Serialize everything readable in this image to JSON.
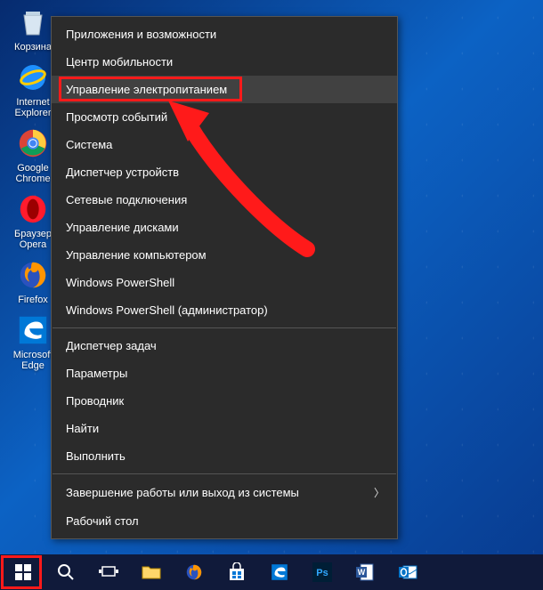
{
  "desktop": {
    "icons": [
      {
        "name": "recycle-bin",
        "label": "Корзина"
      },
      {
        "name": "ie",
        "label": "Internet Explorer"
      },
      {
        "name": "chrome",
        "label": "Google Chrome"
      },
      {
        "name": "opera",
        "label": "Браузер Opera"
      },
      {
        "name": "firefox",
        "label": "Firefox"
      },
      {
        "name": "edge",
        "label": "Microsoft Edge"
      }
    ]
  },
  "context_menu": {
    "groups": [
      [
        {
          "key": "apps-features",
          "label": "Приложения и возможности"
        },
        {
          "key": "mobility-center",
          "label": "Центр мобильности"
        },
        {
          "key": "power-options",
          "label": "Управление электропитанием",
          "highlighted": true
        },
        {
          "key": "event-viewer",
          "label": "Просмотр событий"
        },
        {
          "key": "system",
          "label": "Система"
        },
        {
          "key": "device-manager",
          "label": "Диспетчер устройств"
        },
        {
          "key": "network-connections",
          "label": "Сетевые подключения"
        },
        {
          "key": "disk-management",
          "label": "Управление дисками"
        },
        {
          "key": "computer-management",
          "label": "Управление компьютером"
        },
        {
          "key": "powershell",
          "label": "Windows PowerShell"
        },
        {
          "key": "powershell-admin",
          "label": "Windows PowerShell (администратор)"
        }
      ],
      [
        {
          "key": "task-manager",
          "label": "Диспетчер задач"
        },
        {
          "key": "settings",
          "label": "Параметры"
        },
        {
          "key": "explorer",
          "label": "Проводник"
        },
        {
          "key": "search",
          "label": "Найти"
        },
        {
          "key": "run",
          "label": "Выполнить"
        }
      ],
      [
        {
          "key": "shutdown-signout",
          "label": "Завершение работы или выход из системы",
          "submenu": true
        },
        {
          "key": "desktop",
          "label": "Рабочий стол"
        }
      ]
    ]
  },
  "taskbar": {
    "buttons": [
      {
        "name": "start",
        "highlighted": true
      },
      {
        "name": "search"
      },
      {
        "name": "task-view"
      },
      {
        "name": "file-explorer"
      },
      {
        "name": "firefox"
      },
      {
        "name": "store"
      },
      {
        "name": "edge"
      },
      {
        "name": "photoshop"
      },
      {
        "name": "word"
      },
      {
        "name": "outlook"
      }
    ]
  },
  "annotation": {
    "arrow_color": "#ff1a1a"
  }
}
